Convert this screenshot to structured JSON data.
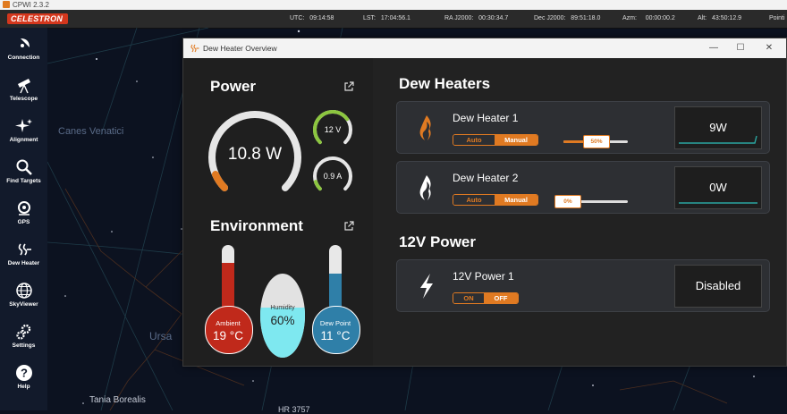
{
  "app": {
    "window_title": "CPWI 2.3.2",
    "brand": "CELESTRON"
  },
  "status": {
    "utc_label": "UTC:",
    "utc": "09:14:58",
    "lst_label": "LST:",
    "lst": "17:04:56.1",
    "ra_label": "RA J2000:",
    "ra": "00:30:34.7",
    "dec_label": "Dec J2000:",
    "dec": "89:51:18.0",
    "azm_label": "Azm:",
    "azm": "00:00:00.2",
    "alt_label": "Alt:",
    "alt": "43:50:12.9",
    "pointing": "Pointi"
  },
  "sidebar": {
    "items": [
      {
        "label": "Connection",
        "icon": "satellite-dish-icon"
      },
      {
        "label": "Telescope",
        "icon": "telescope-icon"
      },
      {
        "label": "Alignment",
        "icon": "sparkle-icon"
      },
      {
        "label": "Find Targets",
        "icon": "magnifier-icon"
      },
      {
        "label": "GPS",
        "icon": "gps-icon"
      },
      {
        "label": "Dew Heater",
        "icon": "heat-icon"
      },
      {
        "label": "SkyViewer",
        "icon": "globe-icon"
      },
      {
        "label": "Settings",
        "icon": "gear-icon"
      },
      {
        "label": "Help",
        "icon": "help-icon"
      }
    ]
  },
  "sky": {
    "labels": [
      "Canes Venatici",
      "Ursa",
      "Tania Borealis",
      "HR 3757"
    ]
  },
  "dialog": {
    "title": "Dew Heater Overview",
    "power": {
      "title": "Power",
      "watts": "10.8 W",
      "watts_fraction": 0.08,
      "volts": "12 V",
      "volts_fraction": 0.7,
      "amps": "0.9 A",
      "amps_fraction": 0.1
    },
    "environment": {
      "title": "Environment",
      "ambient_label": "Ambient",
      "ambient_value": "19 °C",
      "ambient_fraction": 0.75,
      "humidity_label": "Humidity",
      "humidity_value": "60%",
      "humidity_fraction": 0.6,
      "dewpoint_label": "Dew Point",
      "dewpoint_value": "11 °C",
      "dewpoint_fraction": 0.6
    },
    "dew_heaters": {
      "title": "Dew Heaters",
      "items": [
        {
          "name": "Dew Heater 1",
          "mode_auto": "Auto",
          "mode_manual": "Manual",
          "selected": "Manual",
          "level": "50%",
          "level_value": 50,
          "power": "9W",
          "active": true
        },
        {
          "name": "Dew Heater 2",
          "mode_auto": "Auto",
          "mode_manual": "Manual",
          "selected": "Manual",
          "level": "0%",
          "level_value": 0,
          "power": "0W",
          "active": false
        }
      ]
    },
    "power12v": {
      "title": "12V Power",
      "items": [
        {
          "name": "12V Power 1",
          "on_label": "ON",
          "off_label": "OFF",
          "selected": "OFF",
          "status": "Disabled"
        }
      ]
    }
  },
  "colors": {
    "accent": "#e07a22",
    "gauge_green": "#8cc63f",
    "ambient": "#c0291b",
    "dewpoint": "#2f7fa8",
    "humidity": "#7ee8f0"
  }
}
